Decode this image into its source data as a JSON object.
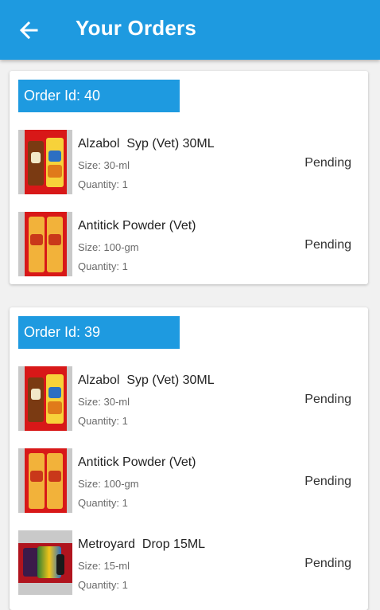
{
  "header": {
    "title": "Your Orders",
    "back_icon": "arrow-left-icon"
  },
  "colors": {
    "primary": "#1e9ae0",
    "background": "#f1f1f1",
    "card": "#ffffff"
  },
  "orders": [
    {
      "order_id_label": "Order Id: 40",
      "items": [
        {
          "name": "Alzabol  Syp (Vet) 30ML",
          "size": "Size: 30-ml",
          "quantity": "Quantity: 1",
          "status": "Pending"
        },
        {
          "name": "Antitick Powder (Vet)",
          "size": "Size: 100-gm",
          "quantity": "Quantity: 1",
          "status": "Pending"
        }
      ]
    },
    {
      "order_id_label": "Order Id: 39",
      "items": [
        {
          "name": "Alzabol  Syp (Vet) 30ML",
          "size": "Size: 30-ml",
          "quantity": "Quantity: 1",
          "status": "Pending"
        },
        {
          "name": "Antitick Powder (Vet)",
          "size": "Size: 100-gm",
          "quantity": "Quantity: 1",
          "status": "Pending"
        },
        {
          "name": "Metroyard  Drop 15ML",
          "size": "Size: 15-ml",
          "quantity": "Quantity: 1",
          "status": "Pending"
        }
      ]
    }
  ]
}
